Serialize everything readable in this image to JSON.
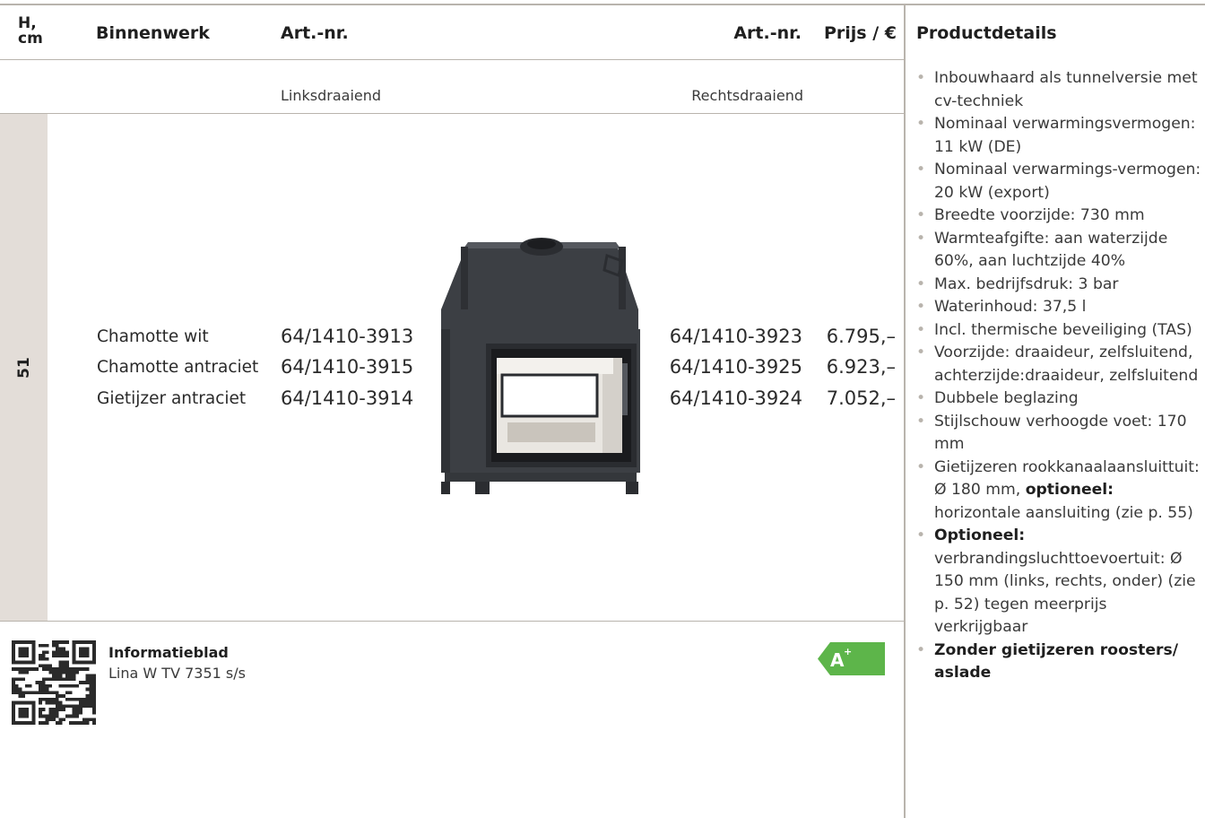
{
  "header": {
    "height_label_line1": "H,",
    "height_label_line2": "cm",
    "binnenwerk": "Binnenwerk",
    "artnr_left": "Art.-nr.",
    "artnr_right": "Art.-nr.",
    "prijs": "Prijs / €",
    "productdetails": "Productdetails"
  },
  "subheader": {
    "left": "Linksdraaiend",
    "right": "Rechtsdraaiend"
  },
  "height_value": "51",
  "rows": [
    {
      "binnenwerk": "Chamotte wit",
      "art_left": "64/1410-3913",
      "art_right": "64/1410-3923",
      "prijs": "6.795,–"
    },
    {
      "binnenwerk": "Chamotte antraciet",
      "art_left": "64/1410-3915",
      "art_right": "64/1410-3925",
      "prijs": "6.923,–"
    },
    {
      "binnenwerk": "Gietijzer antraciet",
      "art_left": "64/1410-3914",
      "art_right": "64/1410-3924",
      "prijs": "7.052,–"
    }
  ],
  "details": [
    {
      "pre": "Inbouwhaard als tunnelversie met cv-techniek"
    },
    {
      "pre": "Nominaal verwarmingsvermogen: 11 kW (DE)"
    },
    {
      "pre": "Nominaal verwarmings-vermogen: 20 kW (export)"
    },
    {
      "pre": "Breedte voorzijde: 730 mm"
    },
    {
      "pre": "Warmteafgifte: aan waterzijde 60%, aan luchtzijde 40%"
    },
    {
      "pre": "Max. bedrijfsdruk: 3 bar"
    },
    {
      "pre": "Waterinhoud: 37,5 l"
    },
    {
      "pre": "Incl. thermische beveiliging (TAS)"
    },
    {
      "pre": "Voorzijde: draaideur, zelfsluitend, achterzijde:draaideur, zelfsluitend"
    },
    {
      "pre": "Dubbele beglazing"
    },
    {
      "pre": "Stijlschouw verhoogde voet: 170 mm"
    },
    {
      "pre": "Gietijzeren rookkanaalaansluittuit: Ø 180 mm, ",
      "bold": "optioneel:",
      "post": " horizontale aansluiting (zie p. 55)"
    },
    {
      "bold": "Optioneel:",
      "post": " verbrandingsluchttoevoertuit: Ø 150 mm (links, rechts, onder) (zie p. 52) tegen meerprijs verkrijgbaar"
    },
    {
      "bold": "Zonder gietijzeren roosters/ aslade"
    }
  ],
  "informatieblad": {
    "title": "Informatieblad",
    "subtitle": "Lina W TV 7351 s/s"
  },
  "energy_label": {
    "text": "A",
    "sup": "+",
    "color": "#5db54a"
  },
  "colors": {
    "rule": "#b9b4ad",
    "height_bar": "#e3ddd8",
    "stove_body": "#3c3f44"
  },
  "icons": {
    "qr": "qr-code-icon",
    "product_image": "fireplace-stove-image"
  }
}
